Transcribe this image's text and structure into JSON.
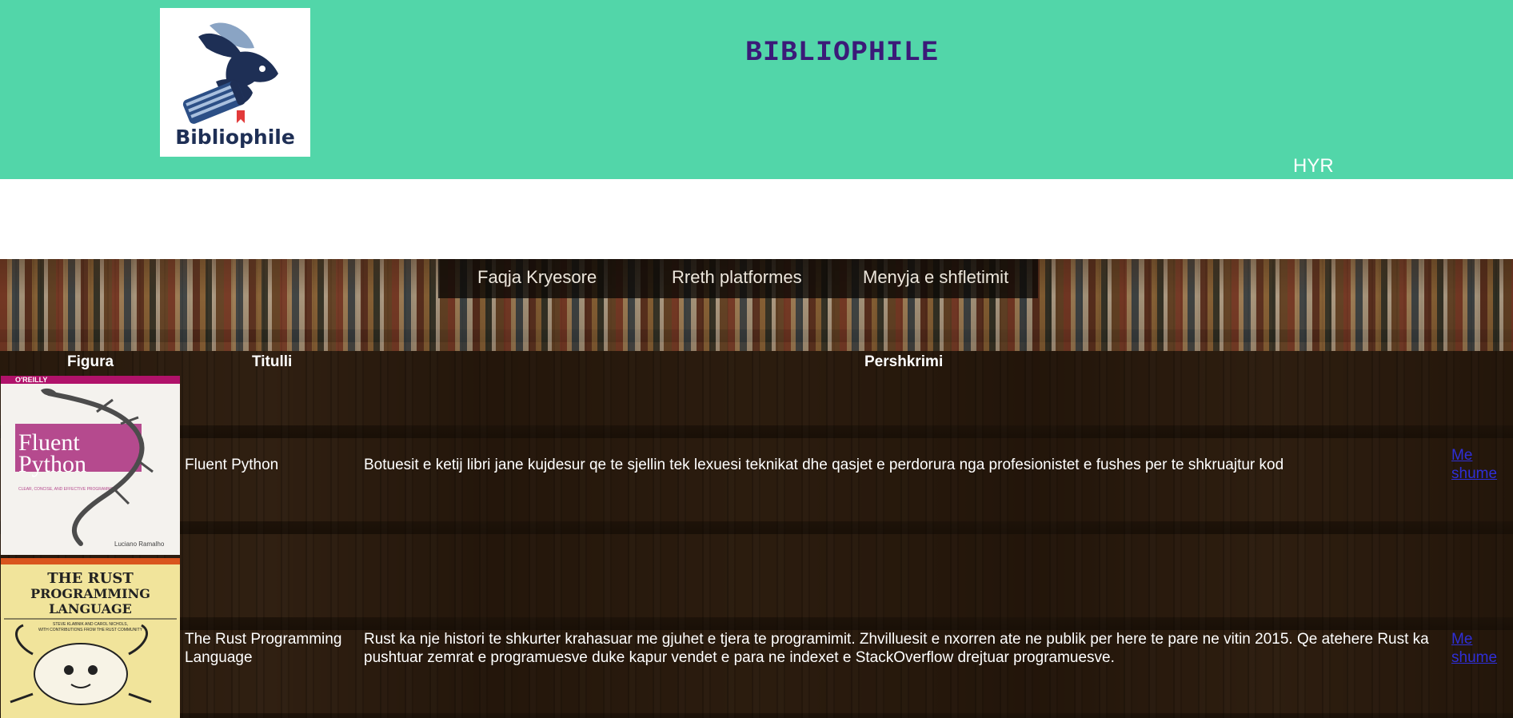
{
  "header": {
    "site_title": "BIBLIOPHILE",
    "logo_text": "Bibliophile",
    "login_label": "HYR"
  },
  "nav": {
    "items": [
      {
        "label": "Faqja Kryesore"
      },
      {
        "label": "Rreth platformes"
      },
      {
        "label": "Menyja e shfletimit"
      }
    ]
  },
  "table": {
    "headers": {
      "figure": "Figura",
      "title": "Titulli",
      "description": "Pershkrimi"
    },
    "rows": [
      {
        "cover": {
          "publisher": "O'REILLY",
          "title_line1": "Fluent",
          "title_line2": "Python",
          "subtitle": "CLEAR, CONCISE, AND EFFECTIVE PROGRAMMING",
          "author": "Luciano Ramalho"
        },
        "title": "Fluent Python",
        "description": "Botuesit e ketij libri jane kujdesur qe te sjellin tek lexuesi teknikat dhe qasjet e perdorura nga profesionistet e fushes per te shkruajtur kod",
        "more_label": "Me shume"
      },
      {
        "cover": {
          "title_line1": "THE RUST",
          "title_line2": "PROGRAMMING",
          "title_line3": "LANGUAGE",
          "authors": "STEVE KLABNIK AND CAROL NICHOLS,",
          "contrib": "WITH CONTRIBUTIONS FROM THE RUST COMMUNITY"
        },
        "title": "The Rust Programming Language",
        "description": "Rust ka nje histori te shkurter krahasuar me gjuhet e tjera te programimit. Zhvilluesit e nxorren ate ne publik per here te pare ne vitin 2015. Qe atehere Rust ka pushtuar zemrat e programuesve duke kapur vendet e para ne indexet e StackOverflow drejtuar programuesve.",
        "more_label": "Me shume"
      }
    ]
  },
  "colors": {
    "header_bg": "#52d6a9",
    "title_color": "#3b1a78",
    "link_color": "#2f2fd8",
    "logo_navy": "#1e2f55",
    "bookmark_red": "#e23a3a"
  }
}
